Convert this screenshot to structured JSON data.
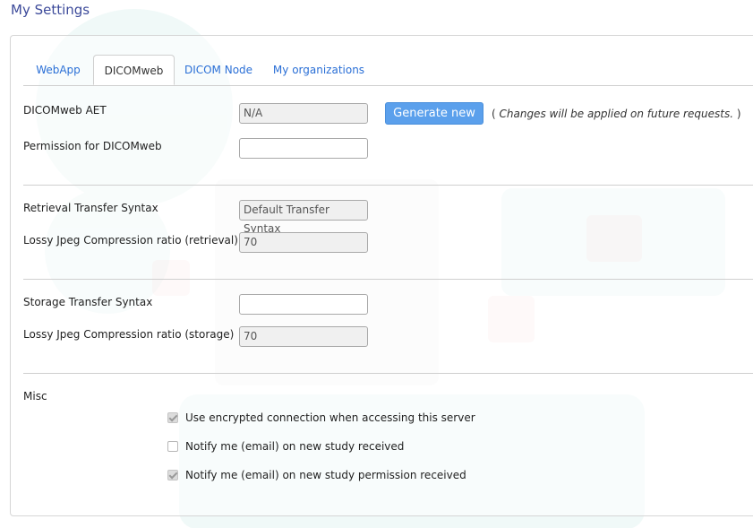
{
  "page": {
    "title": "My Settings"
  },
  "tabs": [
    {
      "label": "WebApp",
      "active": false
    },
    {
      "label": "DICOMweb",
      "active": true
    },
    {
      "label": "DICOM Node",
      "active": false
    },
    {
      "label": "My organizations",
      "active": false
    }
  ],
  "dicomweb": {
    "aet_label": "DICOMweb AET",
    "aet_value": "N/A",
    "generate_label": "Generate new",
    "note_open": "( ",
    "note_text": "Changes will be applied on future requests.",
    "note_close": " )",
    "permission_label": "Permission for DICOMweb",
    "permission_value": ""
  },
  "retrieval": {
    "syntax_label": "Retrieval Transfer Syntax",
    "syntax_value": "Default Transfer Syntax",
    "ratio_label": "Lossy Jpeg Compression ratio (retrieval)",
    "ratio_value": "70"
  },
  "storage": {
    "syntax_label": "Storage Transfer Syntax",
    "syntax_value": "",
    "ratio_label": "Lossy Jpeg Compression ratio (storage)",
    "ratio_value": "70"
  },
  "misc": {
    "label": "Misc",
    "options": [
      {
        "label": "Use encrypted connection when accessing this server",
        "checked": true
      },
      {
        "label": "Notify me (email) on new study received",
        "checked": false
      },
      {
        "label": "Notify me (email) on new study permission received",
        "checked": true
      }
    ]
  },
  "colors": {
    "title": "#3c4a9a",
    "tab_link": "#2a6fd6",
    "button": "#5ba0ec"
  }
}
